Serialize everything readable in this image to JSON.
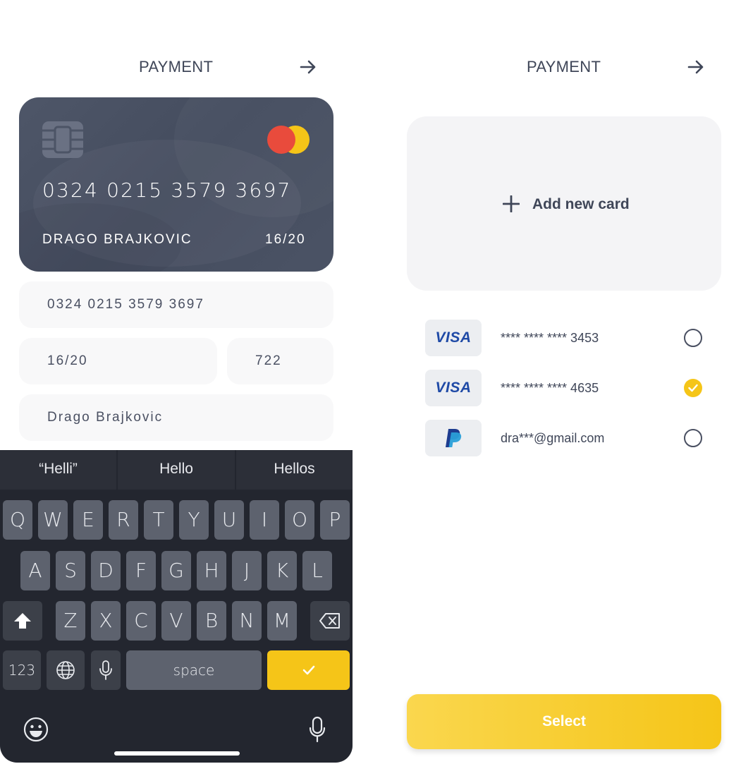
{
  "left": {
    "title": "PAYMENT",
    "card": {
      "number": "0324 0215 3579 3697",
      "holder": "DRAGO BRAJKOVIC",
      "expiry": "16/20",
      "brand_icon": "mastercard-icon"
    },
    "fields": {
      "card_number": "0324 0215 3579 3697",
      "expiry": "16/20",
      "cvv": "722",
      "name": "Drago Brajkovic"
    },
    "keyboard": {
      "suggestions": [
        "“Helli”",
        "Hello",
        "Hellos"
      ],
      "row1": [
        "Q",
        "W",
        "E",
        "R",
        "T",
        "Y",
        "U",
        "I",
        "O",
        "P"
      ],
      "row2": [
        "A",
        "S",
        "D",
        "F",
        "G",
        "H",
        "J",
        "K",
        "L"
      ],
      "row3": [
        "Z",
        "X",
        "C",
        "V",
        "B",
        "N",
        "M"
      ],
      "numbers_key": "123",
      "space_key": "space"
    }
  },
  "right": {
    "title": "PAYMENT",
    "add_card_label": "Add new card",
    "methods": [
      {
        "brand": "VISA",
        "label": "**** **** **** 3453",
        "selected": false
      },
      {
        "brand": "VISA",
        "label": "**** **** **** 4635",
        "selected": true
      },
      {
        "brand": "paypal-icon",
        "label": "dra***@gmail.com",
        "selected": false
      }
    ],
    "select_label": "Select"
  },
  "colors": {
    "accent": "#f5c518",
    "card_bg": "#4a5264",
    "text": "#3f4658",
    "keyboard_bg": "#23262f",
    "visa_blue": "#1f4aa6"
  }
}
